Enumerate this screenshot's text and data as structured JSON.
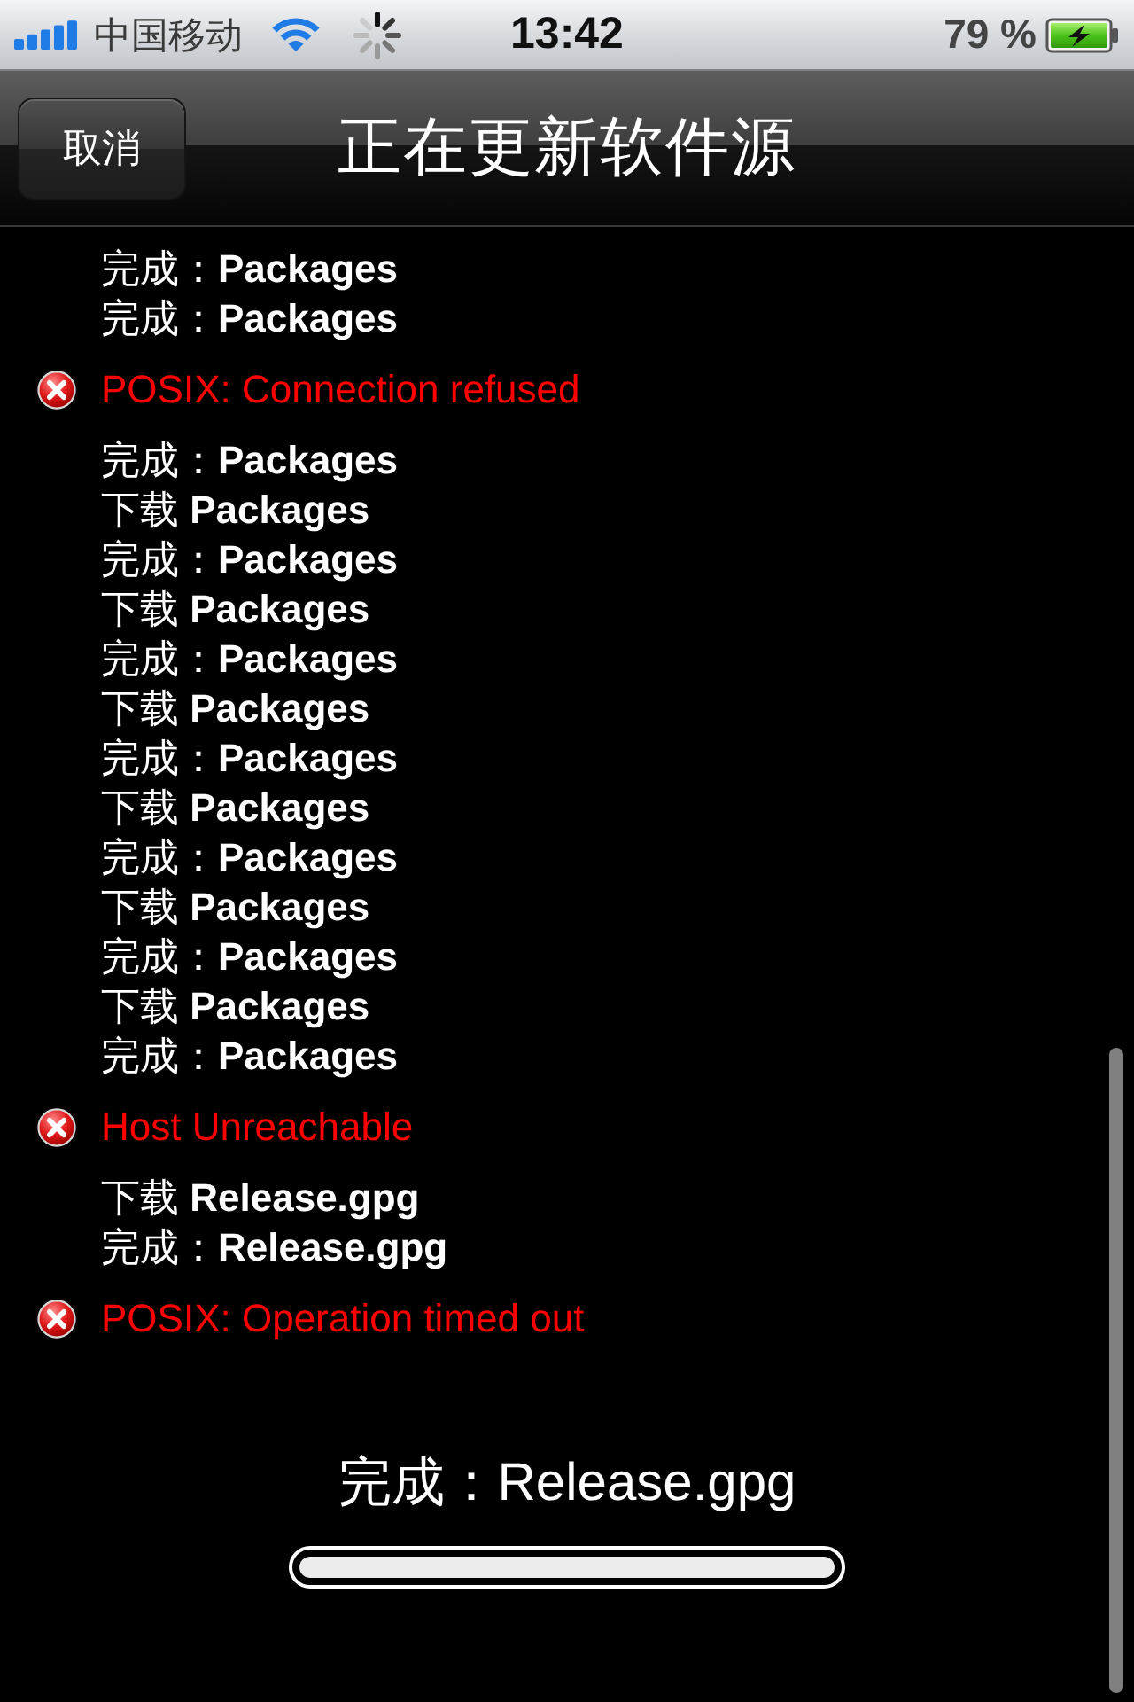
{
  "status_bar": {
    "carrier": "中国移动",
    "time": "13:42",
    "battery": "79 %"
  },
  "nav_bar": {
    "cancel_button": "取消",
    "title": "正在更新软件源"
  },
  "log": [
    {
      "kind": "done",
      "text": "完成：**Packages**"
    },
    {
      "kind": "done",
      "text": "完成：**Packages**"
    },
    {
      "kind": "error",
      "text": "POSIX: Connection refused"
    },
    {
      "kind": "done",
      "text": "完成：**Packages**"
    },
    {
      "kind": "download",
      "text": "下载 **Packages**"
    },
    {
      "kind": "done",
      "text": "完成：**Packages**"
    },
    {
      "kind": "download",
      "text": "下载 **Packages**"
    },
    {
      "kind": "done",
      "text": "完成：**Packages**"
    },
    {
      "kind": "download",
      "text": "下载 **Packages**"
    },
    {
      "kind": "done",
      "text": "完成：**Packages**"
    },
    {
      "kind": "download",
      "text": "下载 **Packages**"
    },
    {
      "kind": "done",
      "text": "完成：**Packages**"
    },
    {
      "kind": "download",
      "text": "下载 **Packages**"
    },
    {
      "kind": "done",
      "text": "完成：**Packages**"
    },
    {
      "kind": "download",
      "text": "下载 **Packages**"
    },
    {
      "kind": "done",
      "text": "完成：**Packages**"
    },
    {
      "kind": "error",
      "text": "Host Unreachable"
    },
    {
      "kind": "download",
      "text": "下载 **Release.gpg**"
    },
    {
      "kind": "done",
      "text": "完成：**Release.gpg**"
    },
    {
      "kind": "error",
      "text": "POSIX: Operation timed out"
    }
  ],
  "progress": {
    "status": "完成：Release.gpg",
    "level": 1
  }
}
